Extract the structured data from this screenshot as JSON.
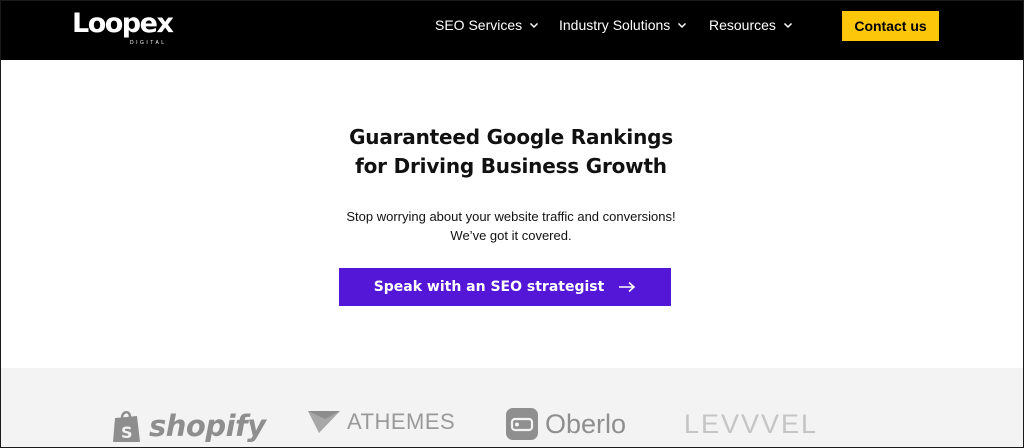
{
  "header": {
    "logo_text": "Loopex",
    "logo_subtext": "DIGITAL",
    "nav": [
      {
        "label": "SEO Services",
        "icon": "chevron-down-icon"
      },
      {
        "label": "Industry Solutions",
        "icon": "chevron-down-icon"
      },
      {
        "label": "Resources",
        "icon": "chevron-down-icon"
      }
    ],
    "contact_label": "Contact us"
  },
  "hero": {
    "title_line1": "Guaranteed Google Rankings",
    "title_line2": "for Driving Business Growth",
    "sub_line1": "Stop worrying about your website traffic and conversions!",
    "sub_line2": "We’ve got it covered.",
    "cta_label": "Speak with an SEO strategist",
    "cta_icon": "arrow-right-icon"
  },
  "brands": [
    {
      "name": "shopify",
      "icon": "shopify-bag-icon"
    },
    {
      "name": "ATHEMES",
      "icon": "athemes-icon"
    },
    {
      "name": "Oberlo",
      "icon": "oberlo-icon"
    },
    {
      "name": "LEVVVEL"
    }
  ],
  "colors": {
    "header_bg": "#000000",
    "contact_bg": "#fcc70a",
    "cta_bg": "#5417d7",
    "logos_bg": "#f3f3f3"
  }
}
